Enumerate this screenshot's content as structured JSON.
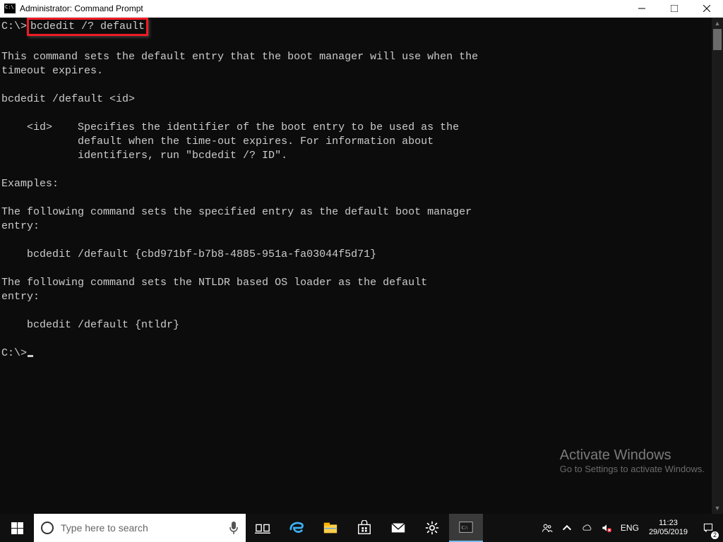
{
  "title_bar": {
    "title": "Administrator: Command Prompt"
  },
  "terminal": {
    "prompt1_prefix": "C:\\>",
    "highlighted_command": "bcdedit /? default",
    "lines": [
      "",
      "This command sets the default entry that the boot manager will use when the",
      "timeout expires.",
      "",
      "bcdedit /default <id>",
      "",
      "    <id>    Specifies the identifier of the boot entry to be used as the",
      "            default when the time-out expires. For information about",
      "            identifiers, run \"bcdedit /? ID\".",
      "",
      "Examples:",
      "",
      "The following command sets the specified entry as the default boot manager",
      "entry:",
      "",
      "    bcdedit /default {cbd971bf-b7b8-4885-951a-fa03044f5d71}",
      "",
      "The following command sets the NTLDR based OS loader as the default",
      "entry:",
      "",
      "    bcdedit /default {ntldr}",
      ""
    ],
    "prompt2": "C:\\>"
  },
  "watermark": {
    "line1": "Activate Windows",
    "line2": "Go to Settings to activate Windows."
  },
  "taskbar": {
    "search_placeholder": "Type here to search",
    "lang": "ENG",
    "time": "11:23",
    "date": "29/05/2019",
    "notif_count": "2"
  }
}
